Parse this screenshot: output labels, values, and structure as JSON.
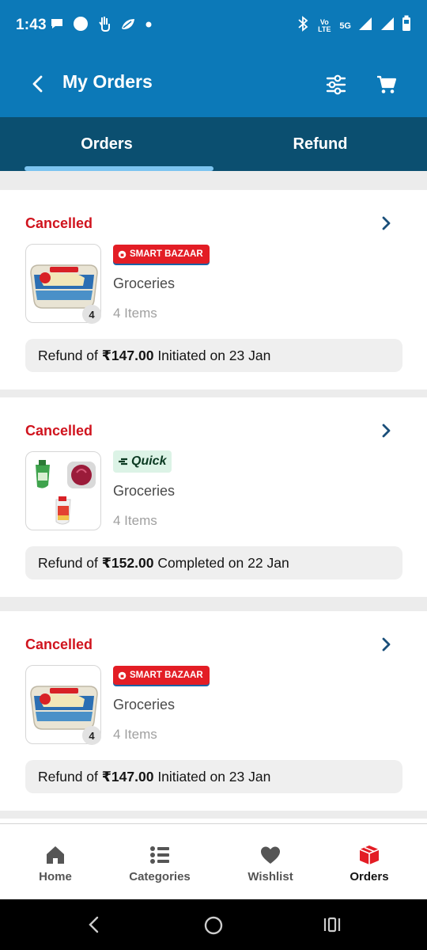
{
  "status_bar": {
    "time": "1:43",
    "left_icons": [
      "chat-bubble-icon",
      "circle-icon",
      "hand-icon",
      "leaf-icon",
      "dot-icon"
    ],
    "right_icons": [
      "bluetooth-icon",
      "volte-icon",
      "5g-icon",
      "signal-icon",
      "signal-icon",
      "battery-icon"
    ],
    "volte_label": "Vo LTE",
    "network_label": "5G"
  },
  "app_bar": {
    "title": "My Orders",
    "back_icon": "chevron-left-icon",
    "filter_icon": "sliders-icon",
    "cart_icon": "cart-icon",
    "background": "#0c79b8"
  },
  "tabs": {
    "items": [
      {
        "label": "Orders",
        "active": true
      },
      {
        "label": "Refund",
        "active": false
      }
    ],
    "background": "#0b4f70",
    "indicator_color": "#7cc4f0"
  },
  "orders": [
    {
      "status": "Cancelled",
      "store": "SMART BAZAAR",
      "store_type": "smart",
      "category": "Groceries",
      "items": "4 Items",
      "qty_badge": "4",
      "refund_prefix": "Refund of ",
      "refund_amount": "₹147.00",
      "refund_suffix": " Initiated on 23 Jan"
    },
    {
      "status": "Cancelled",
      "store": "Quick",
      "store_type": "quick",
      "category": "Groceries",
      "items": "4 Items",
      "qty_badge": "",
      "refund_prefix": "Refund of ",
      "refund_amount": "₹152.00",
      "refund_suffix": " Completed on 22 Jan"
    },
    {
      "status": "Cancelled",
      "store": "SMART BAZAAR",
      "store_type": "smart",
      "category": "Groceries",
      "items": "4 Items",
      "qty_badge": "4",
      "refund_prefix": "Refund of ",
      "refund_amount": "₹147.00",
      "refund_suffix": " Initiated on 23 Jan"
    }
  ],
  "colors": {
    "status_cancelled": "#d0141e",
    "smart_bazaar_red": "#e31d25",
    "quick_green_bg": "#dcf3e6",
    "nav_active": "#e31d25"
  },
  "bottom_nav": [
    {
      "label": "Home",
      "icon": "home-icon",
      "active": false
    },
    {
      "label": "Categories",
      "icon": "categories-icon",
      "active": false
    },
    {
      "label": "Wishlist",
      "icon": "heart-icon",
      "active": false
    },
    {
      "label": "Orders",
      "icon": "box-icon",
      "active": true
    }
  ],
  "system_nav": {
    "icons": [
      "back-icon",
      "home-circle-icon",
      "recents-icon"
    ]
  }
}
